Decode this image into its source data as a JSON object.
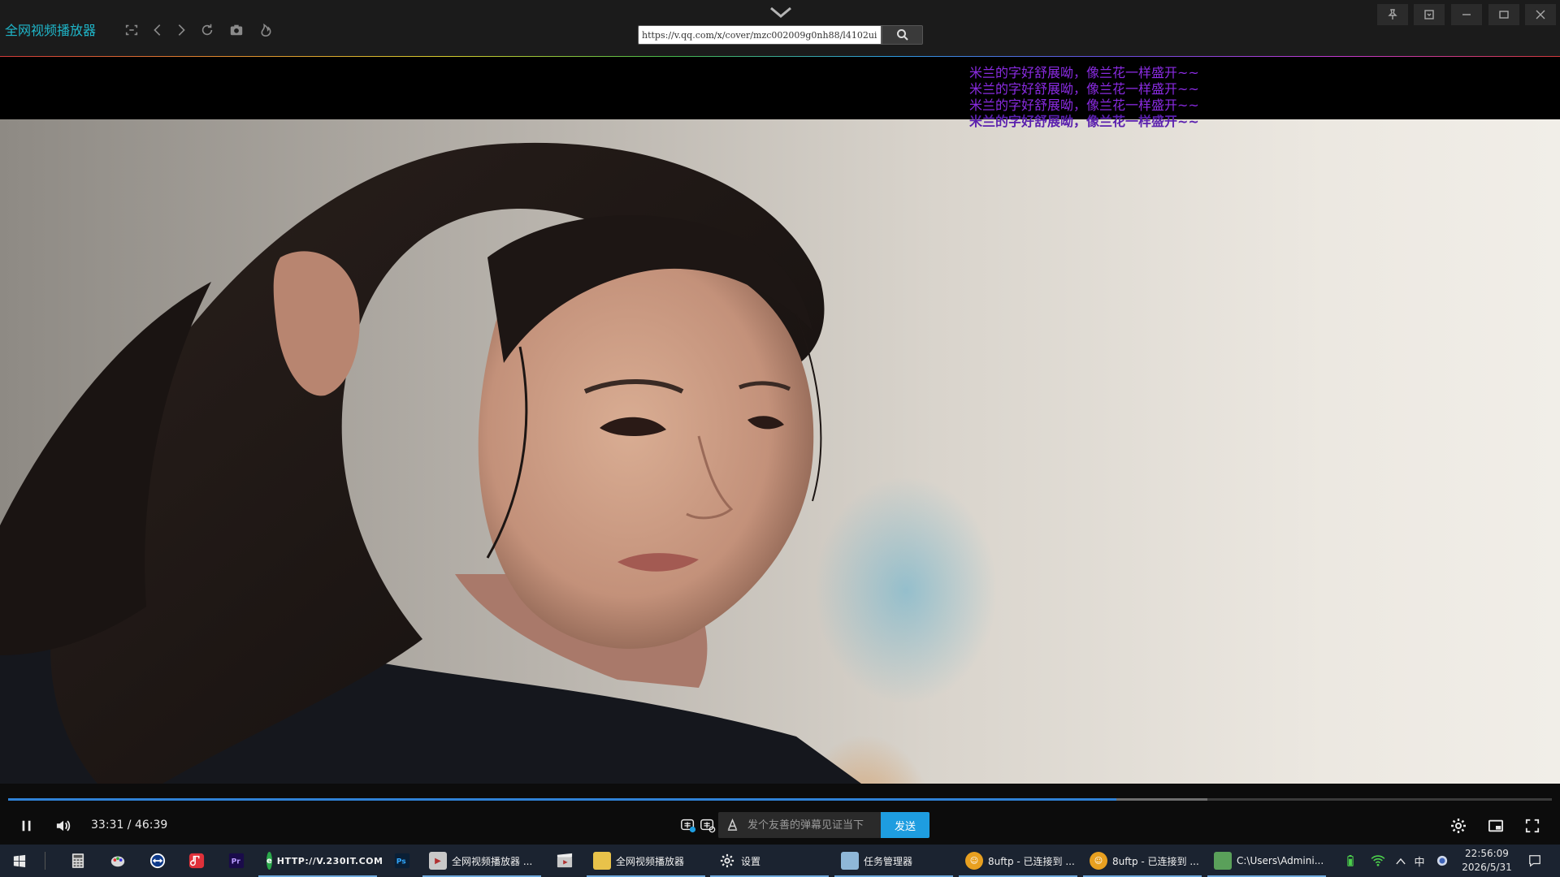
{
  "app": {
    "title": "全网视频播放器"
  },
  "titlebar": {
    "nav_icons": [
      "fullscreen-toggle-icon",
      "back-icon",
      "forward-icon",
      "refresh-icon",
      "screenshot-icon",
      "hot-icon"
    ],
    "url": "https://v.qq.com/x/cover/mzc002009g0nh88/l4102ui",
    "window_buttons": [
      "pin-icon",
      "mini-mode-icon",
      "minimize-icon",
      "maximize-icon",
      "close-icon"
    ]
  },
  "danmaku": [
    "米兰的字好舒展呦，像兰花一样盛开~~",
    "米兰的字好舒展呦，像兰花一样盛开~~",
    "米兰的字好舒展呦，像兰花一样盛开~~",
    "米兰的字好舒展呦，像兰花一样盛开~~"
  ],
  "player": {
    "time": "33:31 / 46:39",
    "progress_played": 0.718,
    "progress_buffered": 0.777,
    "danmaku_placeholder": "发个友善的弹幕见证当下",
    "send_label": "发送",
    "accent": "#1e9de0"
  },
  "taskbar": {
    "items": [
      {
        "label": "HTTP://V.230IT.COM",
        "icon": "browser-icon",
        "color": "#2aa84a"
      },
      {
        "label": "全网视频播放器 ...",
        "icon": "clapper-icon",
        "color": "#c8c8c8"
      },
      {
        "label": "全网视频播放器",
        "icon": "folder-icon",
        "color": "#e8c24a"
      },
      {
        "label": "设置",
        "icon": "gear-icon",
        "color": "#dddddd"
      },
      {
        "label": "任务管理器",
        "icon": "task-manager-icon",
        "color": "#8fb7d8"
      },
      {
        "label": "8uftp - 已连接到 ...",
        "icon": "ftp-icon",
        "color": "#e8a020"
      },
      {
        "label": "8uftp - 已连接到 ...",
        "icon": "ftp-icon",
        "color": "#e8a020"
      },
      {
        "label": "C:\\Users\\Admini...",
        "icon": "notepad-icon",
        "color": "#5aa05a"
      }
    ],
    "ime": "中",
    "clock_time": "22:56:09",
    "clock_date": "2026/5/31"
  }
}
